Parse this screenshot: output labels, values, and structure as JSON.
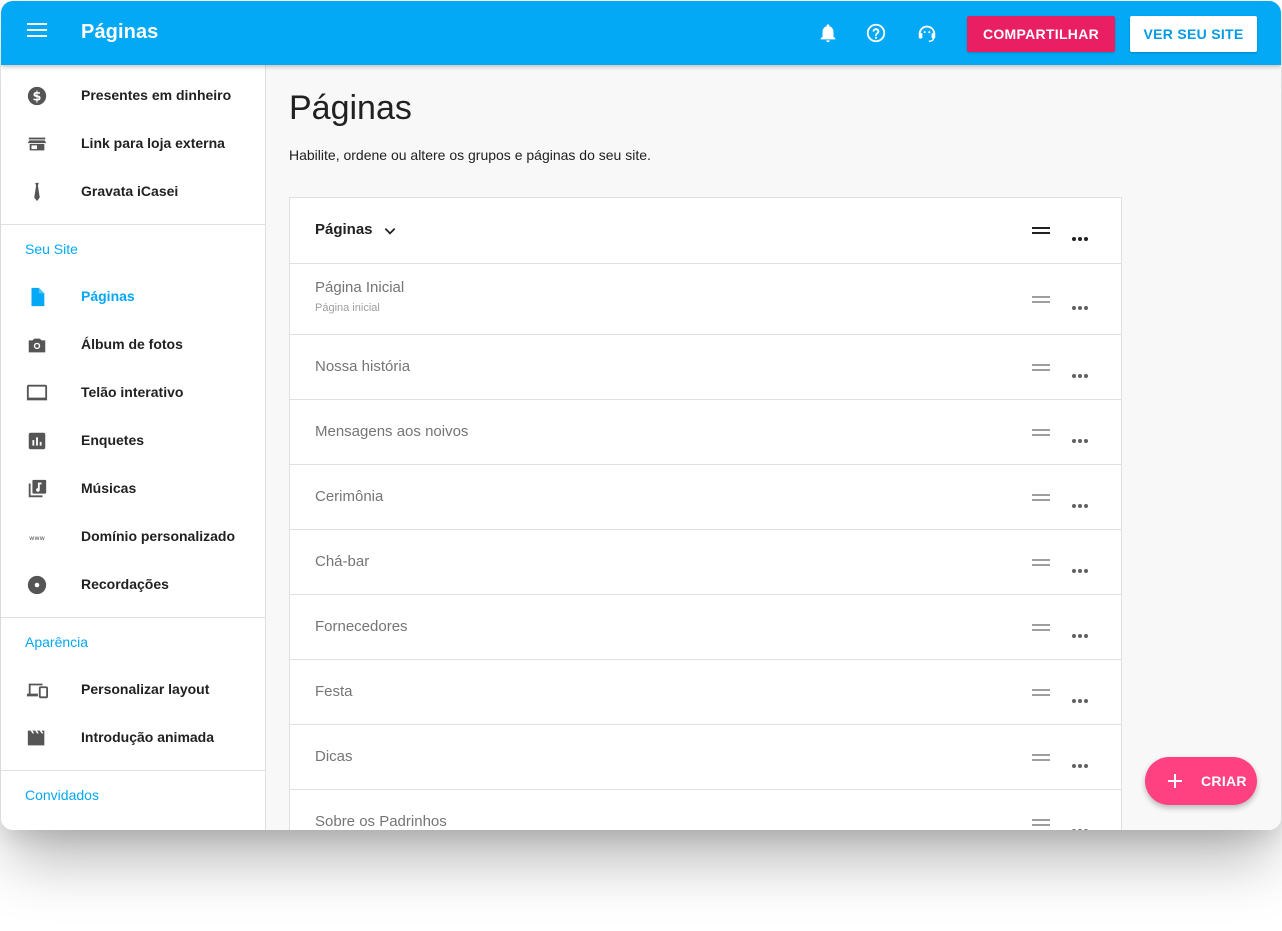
{
  "header": {
    "title": "Páginas",
    "share_label": "COMPARTILHAR",
    "view_site_label": "VER SEU SITE"
  },
  "sidebar": {
    "top_items": [
      {
        "label": "Presentes em dinheiro",
        "icon": "money-icon"
      },
      {
        "label": "Link para loja externa",
        "icon": "store-icon"
      },
      {
        "label": "Gravata iCasei",
        "icon": "tie-icon"
      }
    ],
    "section_site": "Seu Site",
    "site_items": [
      {
        "label": "Páginas",
        "icon": "page-icon",
        "active": true
      },
      {
        "label": "Álbum de fotos",
        "icon": "camera-icon"
      },
      {
        "label": "Telão interativo",
        "icon": "monitor-icon"
      },
      {
        "label": "Enquetes",
        "icon": "poll-icon"
      },
      {
        "label": "Músicas",
        "icon": "music-library-icon"
      },
      {
        "label": "Domínio personalizado",
        "icon": "www-icon"
      },
      {
        "label": "Recordações",
        "icon": "disc-icon"
      }
    ],
    "section_appearance": "Aparência",
    "appearance_items": [
      {
        "label": "Personalizar layout",
        "icon": "devices-icon"
      },
      {
        "label": "Introdução animada",
        "icon": "clapperboard-icon"
      }
    ],
    "section_guests": "Convidados"
  },
  "main": {
    "title": "Páginas",
    "subtitle": "Habilite, ordene ou altere os grupos e páginas do seu site.",
    "group_title": "Páginas",
    "pages": [
      {
        "label": "Página Inicial",
        "sub": "Página inicial"
      },
      {
        "label": "Nossa história",
        "sub": ""
      },
      {
        "label": "Mensagens aos noivos",
        "sub": ""
      },
      {
        "label": "Cerimônia",
        "sub": ""
      },
      {
        "label": "Chá-bar",
        "sub": ""
      },
      {
        "label": "Fornecedores",
        "sub": ""
      },
      {
        "label": "Festa",
        "sub": ""
      },
      {
        "label": "Dicas",
        "sub": ""
      },
      {
        "label": "Sobre os Padrinhos",
        "sub": ""
      }
    ]
  },
  "fab": {
    "label": "CRIAR"
  },
  "colors": {
    "primary": "#03a9f4",
    "accent_share": "#e91e63",
    "fab": "#ff4081"
  }
}
